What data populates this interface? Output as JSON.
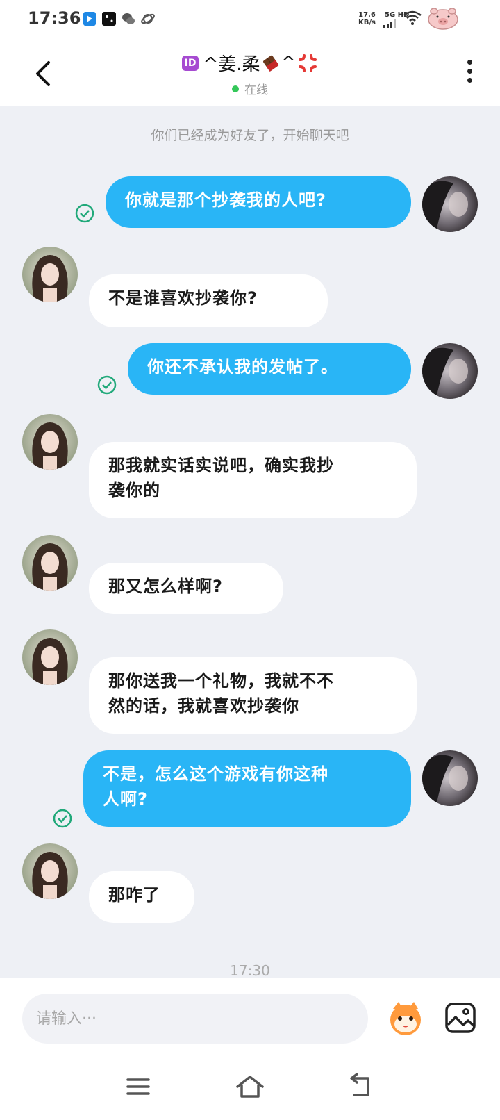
{
  "status_bar": {
    "time": "17:36",
    "net_speed_value": "17.6",
    "net_speed_unit": "KB/s",
    "network_type": "5G HD",
    "icons": [
      "file-icon",
      "stars-app-icon",
      "wechat-icon",
      "planet-icon",
      "signal-icon",
      "wifi-icon",
      "pig-battery-icon"
    ]
  },
  "header": {
    "back_icon": "chevron-left-icon",
    "title_id_badge": "ID",
    "title_text_left": "^姜.柔",
    "title_text_right": "^",
    "status": "在线",
    "status_color": "#34c759",
    "more_icon": "more-vertical-icon"
  },
  "system_message": "你们已经成为好友了，开始聊天吧",
  "colors": {
    "mine_bubble": "#29b5f6",
    "theirs_bubble": "#ffffff",
    "background": "#eef0f5"
  },
  "messages": [
    {
      "from": "me",
      "text": "你就是那个抄袭我的人吧?",
      "read": true
    },
    {
      "from": "them",
      "text": "不是谁喜欢抄袭你?"
    },
    {
      "from": "me",
      "text": "你还不承认我的发帖了。",
      "read": true
    },
    {
      "from": "them",
      "text": "那我就实话实说吧，确实我抄袭你的"
    },
    {
      "from": "them",
      "text": "那又怎么样啊?"
    },
    {
      "from": "them",
      "text": "那你送我一个礼物，我就不不然的话，我就喜欢抄袭你"
    },
    {
      "from": "me",
      "text": "不是，怎么这个游戏有你这种人啊?",
      "read": true
    },
    {
      "from": "them",
      "text": "那咋了"
    }
  ],
  "message_lines": {
    "m3_line1": "那我就实话实说吧，确实我抄",
    "m3_line2": "袭你的",
    "m5_line1": "那你送我一个礼物，我就不不",
    "m5_line2": "然的话，我就喜欢抄袭你",
    "m6_line1": "不是，怎么这个游戏有你这种",
    "m6_line2": "人啊?"
  },
  "timestamp": "17:30",
  "input": {
    "placeholder": "请输入···",
    "emoji_icon": "cartoon-face-icon",
    "image_icon": "image-icon"
  },
  "nav": {
    "menu_icon": "menu-icon",
    "home_icon": "home-icon",
    "back_icon": "back-arrow-icon"
  }
}
